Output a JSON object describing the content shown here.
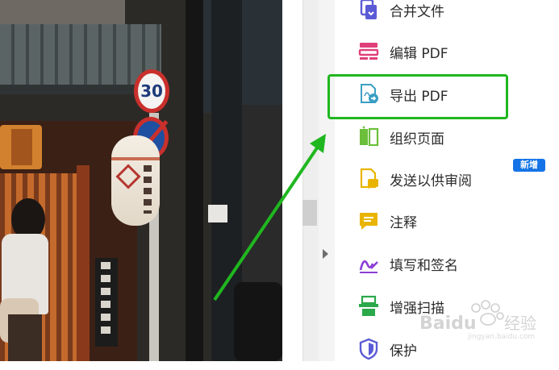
{
  "photo": {
    "speed_sign": "30"
  },
  "tools": [
    {
      "label": "合并文件",
      "icon": "combine-files-icon"
    },
    {
      "label": "编辑 PDF",
      "icon": "edit-pdf-icon"
    },
    {
      "label": "导出 PDF",
      "icon": "export-pdf-icon",
      "highlighted": true
    },
    {
      "label": "组织页面",
      "icon": "organize-pages-icon"
    },
    {
      "label": "发送以供审阅",
      "icon": "send-for-review-icon",
      "badge": "新增"
    },
    {
      "label": "注释",
      "icon": "comment-icon"
    },
    {
      "label": "填写和签名",
      "icon": "fill-sign-icon"
    },
    {
      "label": "增强扫描",
      "icon": "enhance-scans-icon"
    },
    {
      "label": "保护",
      "icon": "protect-icon"
    }
  ],
  "colors": {
    "highlight": "#1fb71f",
    "badge": "#1473e6",
    "combine": "#5b5bd6",
    "edit": "#e0407a",
    "export": "#3a9fc4",
    "organize": "#6bbf3a",
    "send": "#e9b400",
    "comment": "#e9b400",
    "sign": "#8b3fd6",
    "scan": "#2aa84a",
    "protect": "#5b5bd6"
  },
  "watermark": {
    "brand": "Baidu",
    "suffix": "经验",
    "url": "jingyan.baidu.com"
  }
}
